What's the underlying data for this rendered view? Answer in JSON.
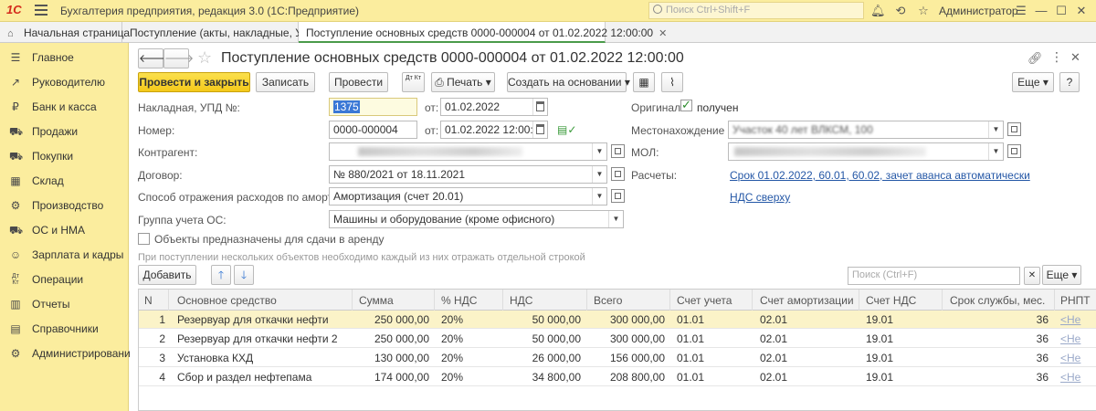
{
  "titlebar": {
    "logo": "1С",
    "app_title": "Бухгалтерия предприятия, редакция 3.0  (1С:Предприятие)",
    "search_placeholder": "Поиск Ctrl+Shift+F",
    "user": "Администратор"
  },
  "tabs": [
    {
      "label": "Начальная страница"
    },
    {
      "label": "Поступление (акты, накладные, УПД)"
    },
    {
      "label": "Поступление основных средств 0000-000004 от 01.02.2022 12:00:00"
    }
  ],
  "sidebar": {
    "items": [
      {
        "label": "Главное",
        "icon": "menu-icon"
      },
      {
        "label": "Руководителю",
        "icon": "chart-line-icon"
      },
      {
        "label": "Банк и касса",
        "icon": "ruble-coin-icon"
      },
      {
        "label": "Продажи",
        "icon": "cart-sell-icon"
      },
      {
        "label": "Покупки",
        "icon": "cart-buy-icon"
      },
      {
        "label": "Склад",
        "icon": "warehouse-icon"
      },
      {
        "label": "Производство",
        "icon": "gear-icon"
      },
      {
        "label": "ОС и НМА",
        "icon": "truck-icon"
      },
      {
        "label": "Зарплата и кадры",
        "icon": "people-icon"
      },
      {
        "label": "Операции",
        "icon": "dt-kt-icon"
      },
      {
        "label": "Отчеты",
        "icon": "report-icon"
      },
      {
        "label": "Справочники",
        "icon": "books-icon"
      },
      {
        "label": "Администрирование",
        "icon": "settings-icon"
      }
    ]
  },
  "document": {
    "title": "Поступление основных средств 0000-000004 от 01.02.2022 12:00:00"
  },
  "toolbar": {
    "post_and_close": "Провести и закрыть",
    "save": "Записать",
    "post": "Провести",
    "print": "Печать",
    "create_based": "Создать на основании",
    "more": "Еще",
    "dt_kt": "Дт Кт"
  },
  "fields": {
    "invoice_label": "Накладная, УПД №:",
    "invoice_value": "1375",
    "from_label": "от:",
    "invoice_date": "01.02.2022",
    "number_label": "Номер:",
    "number_value": "0000-000004",
    "number_date": "01.02.2022 12:00:00",
    "counterparty_label": "Контрагент:",
    "contract_label": "Договор:",
    "contract_value": "№ 880/2021 от 18.11.2021",
    "depreciation_label": "Способ отражения расходов по амортизации:",
    "depreciation_value": "Амортизация (счет 20.01)",
    "group_label": "Группа учета ОС:",
    "group_value": "Машины и оборудование (кроме офисного)",
    "lease_label": "Объекты предназначены для сдачи в аренду",
    "original_label": "Оригинал:",
    "original_value": "получен",
    "location_label": "Местонахождение ОС:",
    "location_value": "Участок 40 лет ВЛКСМ, 100",
    "mol_label": "МОЛ:",
    "settlements_label": "Расчеты:",
    "settlements_link": "Срок 01.02.2022, 60.01, 60.02, зачет аванса автоматически",
    "vat_link": "НДС сверху"
  },
  "table_section": {
    "hint": "При поступлении нескольких объектов необходимо каждый из них отражать отдельной строкой",
    "add_button": "Добавить",
    "search_placeholder": "Поиск (Ctrl+F)",
    "more": "Еще",
    "columns": [
      "N",
      "Основное средство",
      "Сумма",
      "% НДС",
      "НДС",
      "Всего",
      "Счет учета",
      "Счет амортизации",
      "Счет НДС",
      "Срок службы, мес.",
      "РНПТ"
    ],
    "rows": [
      {
        "n": "1",
        "asset": "Резервуар для откачки нефти",
        "sum": "250 000,00",
        "vat_rate": "20%",
        "vat": "50 000,00",
        "total": "300 000,00",
        "account": "01.01",
        "dep_account": "02.01",
        "vat_account": "19.01",
        "life": "36",
        "rnpt": "<Не"
      },
      {
        "n": "2",
        "asset": "Резервуар для откачки нефти 2",
        "sum": "250 000,00",
        "vat_rate": "20%",
        "vat": "50 000,00",
        "total": "300 000,00",
        "account": "01.01",
        "dep_account": "02.01",
        "vat_account": "19.01",
        "life": "36",
        "rnpt": "<Не"
      },
      {
        "n": "3",
        "asset": "Установка КХД",
        "sum": "130 000,00",
        "vat_rate": "20%",
        "vat": "26 000,00",
        "total": "156 000,00",
        "account": "01.01",
        "dep_account": "02.01",
        "vat_account": "19.01",
        "life": "36",
        "rnpt": "<Не"
      },
      {
        "n": "4",
        "asset": "Сбор и раздел нефтепама",
        "sum": "174 000,00",
        "vat_rate": "20%",
        "vat": "34 800,00",
        "total": "208 800,00",
        "account": "01.01",
        "dep_account": "02.01",
        "vat_account": "19.01",
        "life": "36",
        "rnpt": "<Не"
      }
    ]
  }
}
